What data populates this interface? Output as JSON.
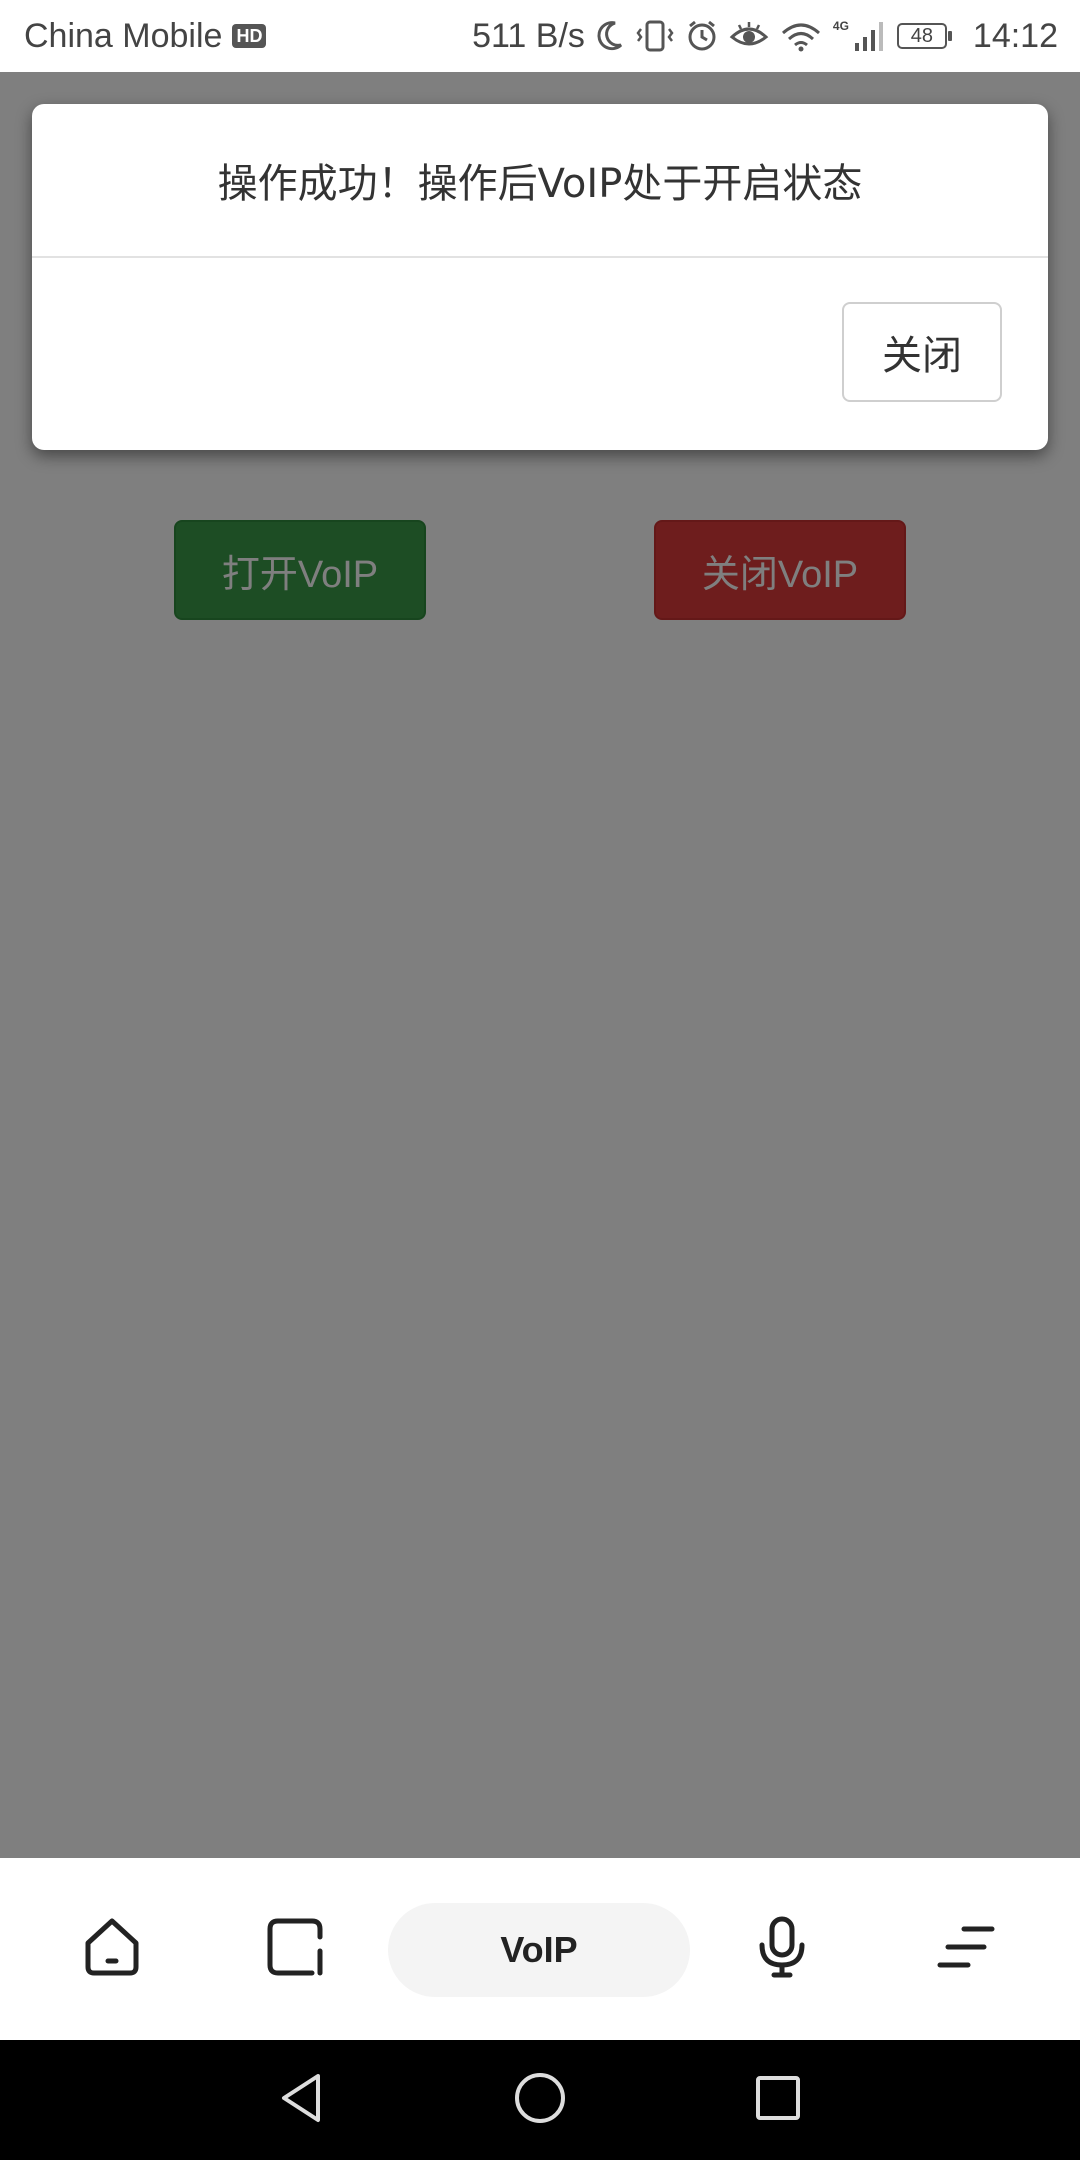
{
  "status_bar": {
    "carrier": "China Mobile",
    "hd_badge": "HD",
    "net_speed": "511 B/s",
    "network_type": "4G",
    "battery": "48",
    "time": "14:12",
    "icons": [
      "moon-icon",
      "vibrate-icon",
      "alarm-icon",
      "eye-icon",
      "wifi-icon",
      "signal-icon",
      "battery-icon"
    ]
  },
  "page": {
    "open_voip_label": "打开VoIP",
    "close_voip_label": "关闭VoIP",
    "open_color": "#3a9a48",
    "close_color": "#dc3a3a"
  },
  "dialog": {
    "message": "操作成功！操作后VoIP处于开启状态",
    "close_label": "关闭"
  },
  "tab_bar": {
    "active_label": "VoIP",
    "icons": [
      "home-icon",
      "square-icon",
      "microphone-icon",
      "menu-icon"
    ]
  },
  "nav_bar": {
    "icons": [
      "back-icon",
      "home-circle-icon",
      "recents-icon"
    ]
  }
}
